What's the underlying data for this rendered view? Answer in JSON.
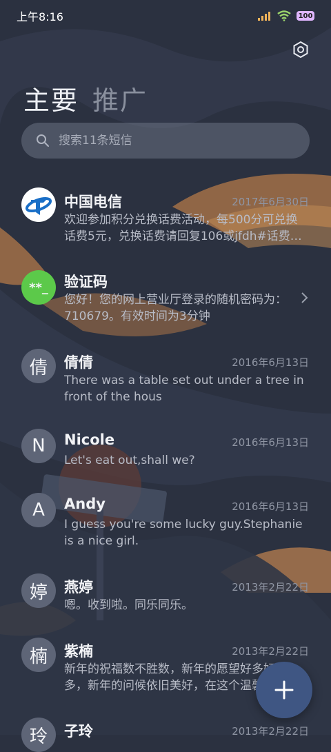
{
  "status_bar": {
    "time": "上午8:16",
    "battery": "100"
  },
  "tabs": [
    {
      "label": "主要",
      "active": true
    },
    {
      "label": "推广",
      "active": false
    }
  ],
  "search": {
    "placeholder": "搜索11条短信"
  },
  "messages": [
    {
      "name": "中国电信",
      "date": "2017年6月30日",
      "preview": "欢迎参加积分兑换话费活动，每500分可兑换话费5元，兑换话费请回复106或jfdh#话费…",
      "avatar_text": "",
      "avatar_icon": "china-telecom-logo"
    },
    {
      "name": "验证码",
      "date": "",
      "preview": "您好！您的网上营业厅登录的随机密码为：710679。有效时间为3分钟",
      "avatar_text": "**_",
      "avatar_color": "#5cc94a"
    },
    {
      "name": "倩倩",
      "date": "2016年6月13日",
      "preview": "There was a table set out under a tree in front of the hous",
      "avatar_text": "倩"
    },
    {
      "name": "Nicole",
      "date": "2016年6月13日",
      "preview": "Let's eat out,shall we?",
      "avatar_text": "N"
    },
    {
      "name": "Andy",
      "date": "2016年6月13日",
      "preview": "I guess you're some lucky guy.Stephanie is a nice girl.",
      "avatar_text": "A"
    },
    {
      "name": "燕婷",
      "date": "2013年2月22日",
      "preview": "嗯。收到啦。同乐同乐。",
      "avatar_text": "婷"
    },
    {
      "name": "紫楠",
      "date": "2013年2月22日",
      "preview": "新年的祝福数不胜数，新年的愿望好多好多，新年的问候依旧美好，在这个温馨的",
      "avatar_text": "楠"
    },
    {
      "name": "子玲",
      "date": "2013年2月22日",
      "preview": "",
      "avatar_text": "玲"
    }
  ],
  "colors": {
    "background": "#2b3140",
    "fab": "#3f5683",
    "verification_avatar": "#5cc94a"
  }
}
